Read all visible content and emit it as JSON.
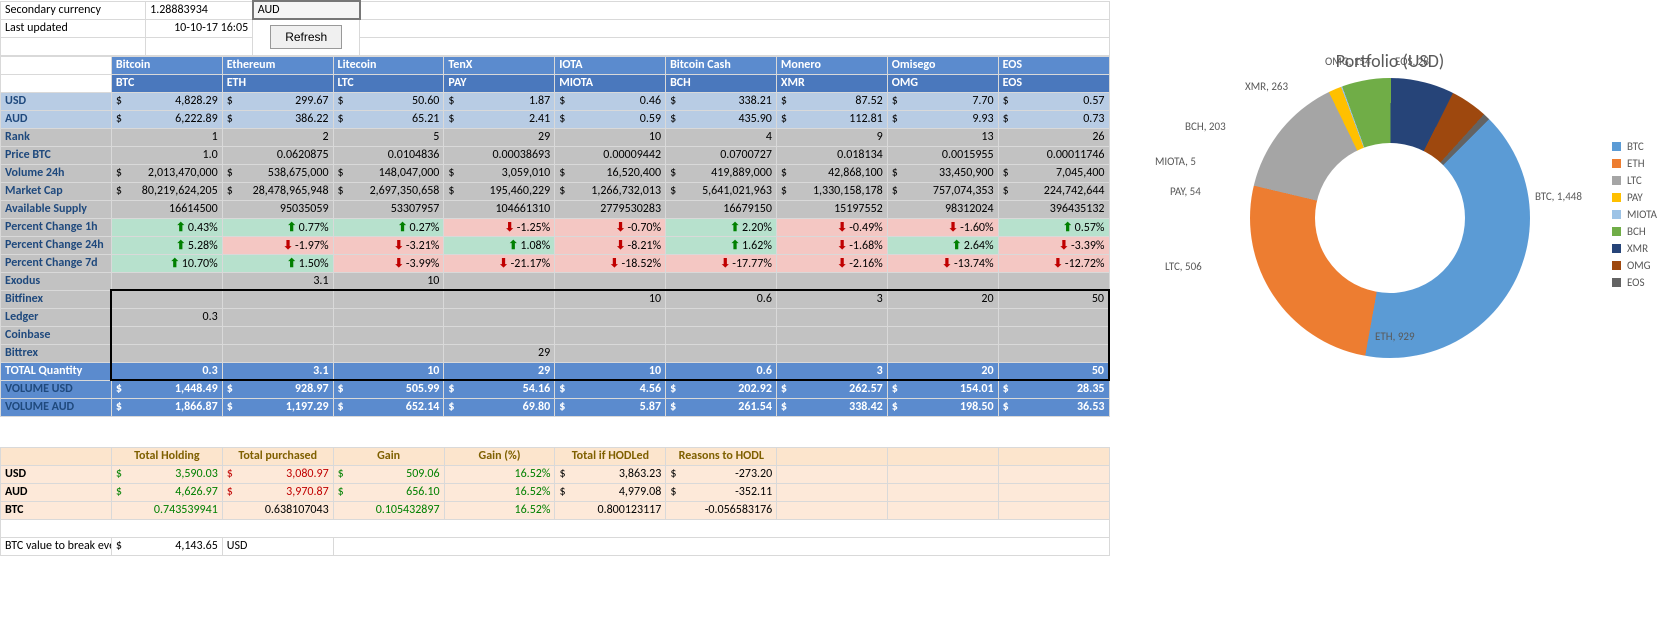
{
  "top": {
    "secondary_currency_label": "Secondary currency",
    "secondary_currency_value": "1.28883934",
    "secondary_currency_code": "AUD",
    "last_updated_label": "Last updated",
    "last_updated_value": "10-10-17 16:05",
    "refresh": "Refresh"
  },
  "coins": [
    {
      "name": "Bitcoin",
      "sym": "BTC"
    },
    {
      "name": "Ethereum",
      "sym": "ETH"
    },
    {
      "name": "Litecoin",
      "sym": "LTC"
    },
    {
      "name": "TenX",
      "sym": "PAY"
    },
    {
      "name": "IOTA",
      "sym": "MIOTA"
    },
    {
      "name": "Bitcoin Cash",
      "sym": "BCH"
    },
    {
      "name": "Monero",
      "sym": "XMR"
    },
    {
      "name": "Omisego",
      "sym": "OMG"
    },
    {
      "name": "EOS",
      "sym": "EOS"
    }
  ],
  "rows": {
    "usd": {
      "label": "USD",
      "vals": [
        "4,828.29",
        "299.67",
        "50.60",
        "1.87",
        "0.46",
        "338.21",
        "87.52",
        "7.70",
        "0.57"
      ]
    },
    "aud": {
      "label": "AUD",
      "vals": [
        "6,222.89",
        "386.22",
        "65.21",
        "2.41",
        "0.59",
        "435.90",
        "112.81",
        "9.93",
        "0.73"
      ]
    },
    "rank": {
      "label": "Rank",
      "vals": [
        "1",
        "2",
        "5",
        "29",
        "10",
        "4",
        "9",
        "13",
        "26"
      ]
    },
    "price_btc": {
      "label": "Price BTC",
      "vals": [
        "1.0",
        "0.0620875",
        "0.0104836",
        "0.00038693",
        "0.00009442",
        "0.0700727",
        "0.018134",
        "0.0015955",
        "0.00011746"
      ]
    },
    "vol24": {
      "label": "Volume 24h",
      "vals": [
        "2,013,470,000",
        "538,675,000",
        "148,047,000",
        "3,059,010",
        "16,520,400",
        "419,889,000",
        "42,868,100",
        "33,450,900",
        "7,045,400"
      ]
    },
    "mcap": {
      "label": "Market Cap",
      "vals": [
        "80,219,624,205",
        "28,478,965,948",
        "2,697,350,658",
        "195,460,229",
        "1,266,732,013",
        "5,641,021,963",
        "1,330,158,178",
        "757,074,353",
        "224,742,644"
      ]
    },
    "supply": {
      "label": "Available Supply",
      "vals": [
        "16614500",
        "95035059",
        "53307957",
        "104661310",
        "2779530283",
        "16679150",
        "15197552",
        "98312024",
        "396435132"
      ]
    },
    "pc1h": {
      "label": "Percent Change 1h",
      "vals": [
        "0.43%",
        "0.77%",
        "0.27%",
        "-1.25%",
        "-0.70%",
        "2.20%",
        "-0.49%",
        "-1.60%",
        "0.57%"
      ],
      "dir": [
        "up",
        "up",
        "up",
        "dn",
        "dn",
        "up",
        "dn",
        "dn",
        "up"
      ]
    },
    "pc24h": {
      "label": "Percent Change 24h",
      "vals": [
        "5.28%",
        "-1.97%",
        "-3.21%",
        "1.08%",
        "-8.21%",
        "1.62%",
        "-1.68%",
        "2.64%",
        "-3.39%"
      ],
      "dir": [
        "up",
        "dn",
        "dn",
        "up",
        "dn",
        "up",
        "dn",
        "up",
        "dn"
      ]
    },
    "pc7d": {
      "label": "Percent Change 7d",
      "vals": [
        "10.70%",
        "1.50%",
        "-3.99%",
        "-21.17%",
        "-18.52%",
        "-17.77%",
        "-2.16%",
        "-13.74%",
        "-12.72%"
      ],
      "dir": [
        "up",
        "up",
        "dn",
        "dn",
        "dn",
        "dn",
        "dn",
        "dn",
        "dn"
      ]
    }
  },
  "holdings": {
    "wallets": [
      "Exodus",
      "Bitfinex",
      "Ledger",
      "Coinbase",
      "Bittrex"
    ],
    "data": [
      [
        "",
        "3.1",
        "10",
        "",
        "",
        "",
        "",
        "",
        ""
      ],
      [
        "",
        "",
        "",
        "",
        "10",
        "0.6",
        "3",
        "20",
        "50"
      ],
      [
        "0.3",
        "",
        "",
        "",
        "",
        "",
        "",
        "",
        ""
      ],
      [
        "",
        "",
        "",
        "",
        "",
        "",
        "",
        "",
        ""
      ],
      [
        "",
        "",
        "",
        "29",
        "",
        "",
        "",
        "",
        ""
      ]
    ],
    "total_qty": {
      "label": "TOTAL Quantity",
      "vals": [
        "0.3",
        "3.1",
        "10",
        "29",
        "10",
        "0.6",
        "3",
        "20",
        "50"
      ]
    },
    "vol_usd": {
      "label": "VOLUME USD",
      "vals": [
        "1,448.49",
        "928.97",
        "505.99",
        "54.16",
        "4.56",
        "202.92",
        "262.57",
        "154.01",
        "28.35"
      ]
    },
    "vol_aud": {
      "label": "VOLUME AUD",
      "vals": [
        "1,866.87",
        "1,197.29",
        "652.14",
        "69.80",
        "5.87",
        "261.54",
        "338.42",
        "198.50",
        "36.53"
      ]
    }
  },
  "summary": {
    "headers": [
      "Total Holding",
      "Total purchased",
      "Gain",
      "Gain (%)",
      "Total if HODLed",
      "Reasons to HODL"
    ],
    "usd": {
      "label": "USD",
      "vals": [
        "3,590.03",
        "3,080.97",
        "509.06",
        "16.52%",
        "3,863.23",
        "-273.20"
      ]
    },
    "aud": {
      "label": "AUD",
      "vals": [
        "4,626.97",
        "3,970.87",
        "656.10",
        "16.52%",
        "4,979.08",
        "-352.11"
      ]
    },
    "btc": {
      "label": "BTC",
      "vals": [
        "0.743539941",
        "0.638107043",
        "0.105432897",
        "16.52%",
        "0.800123117",
        "-0.056583176"
      ]
    },
    "break_even_label": "BTC value to break even",
    "break_even_val": "4,143.65",
    "break_even_cur": "USD"
  },
  "chart_data": {
    "type": "pie",
    "title": "Portfolio (USD)",
    "series": [
      {
        "name": "BTC",
        "value": 1448,
        "color": "#5b9bd5"
      },
      {
        "name": "ETH",
        "value": 929,
        "color": "#ed7d31"
      },
      {
        "name": "LTC",
        "value": 506,
        "color": "#a5a5a5"
      },
      {
        "name": "PAY",
        "value": 54,
        "color": "#ffc000"
      },
      {
        "name": "MIOTA",
        "value": 5,
        "color": "#9dc3e6"
      },
      {
        "name": "BCH",
        "value": 203,
        "color": "#70ad47"
      },
      {
        "name": "XMR",
        "value": 263,
        "color": "#264478"
      },
      {
        "name": "OMG",
        "value": 154,
        "color": "#9e480e"
      },
      {
        "name": "EOS",
        "value": 28,
        "color": "#636363"
      }
    ]
  }
}
